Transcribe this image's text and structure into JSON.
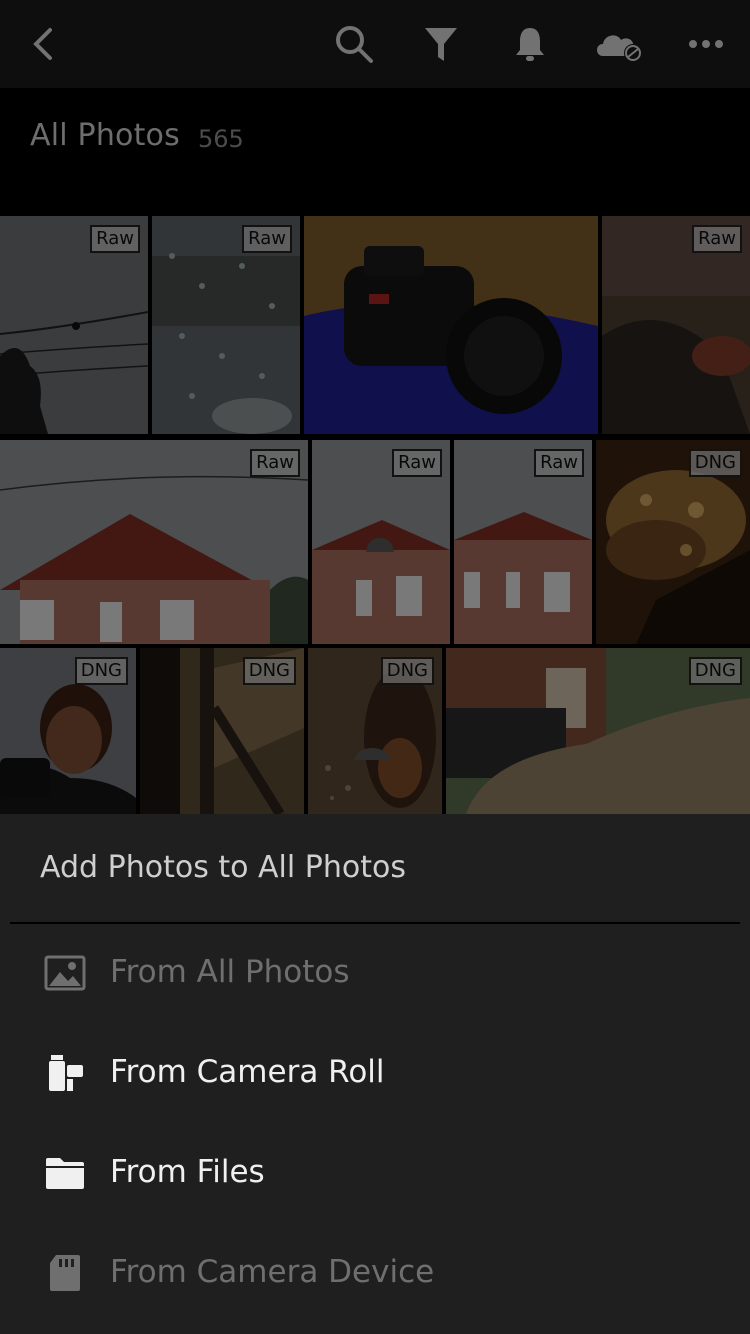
{
  "header": {
    "title": "All Photos",
    "count": "565",
    "icons": [
      "back-icon",
      "search-icon",
      "filter-icon",
      "bell-icon",
      "cloud-sync-icon",
      "more-icon"
    ]
  },
  "grid": {
    "photos": [
      {
        "badge": "Raw",
        "subject": "sky-wires-bird"
      },
      {
        "badge": "Raw",
        "subject": "rain-window"
      },
      {
        "badge": "",
        "subject": "camera"
      },
      {
        "badge": "Raw",
        "subject": "dark-interior"
      },
      {
        "badge": "Raw",
        "subject": "house"
      },
      {
        "badge": "Raw",
        "subject": "house"
      },
      {
        "badge": "Raw",
        "subject": "house"
      },
      {
        "badge": "DNG",
        "subject": "food"
      },
      {
        "badge": "DNG",
        "subject": "portrait"
      },
      {
        "badge": "DNG",
        "subject": "window-shadow"
      },
      {
        "badge": "DNG",
        "subject": "dog"
      },
      {
        "badge": "DNG",
        "subject": "covered-car"
      }
    ]
  },
  "sheet": {
    "title": "Add Photos to All Photos",
    "options": [
      {
        "label": "From All Photos",
        "icon": "image-icon",
        "enabled": false
      },
      {
        "label": "From Camera Roll",
        "icon": "camera-roll-icon",
        "enabled": true
      },
      {
        "label": "From Files",
        "icon": "folder-icon",
        "enabled": true
      },
      {
        "label": "From Camera Device",
        "icon": "sd-card-icon",
        "enabled": false
      }
    ]
  },
  "colors": {
    "topbar": "#1a1a1a",
    "sheet": "#1f1f1f",
    "enabled_text": "#f0f0f0",
    "disabled_text": "#6f6f6f"
  }
}
